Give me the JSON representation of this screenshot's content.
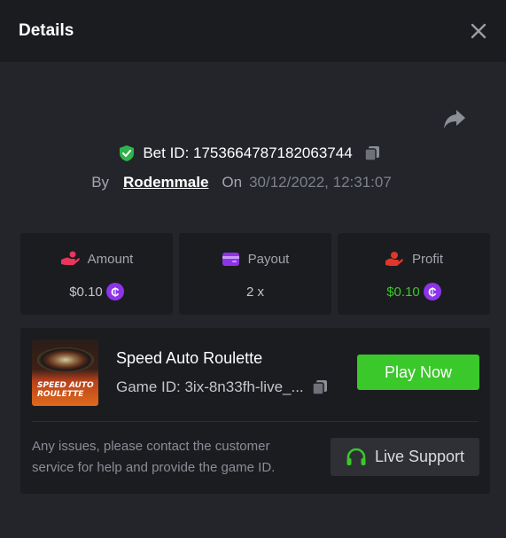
{
  "header": {
    "title": "Details"
  },
  "bet": {
    "label": "Bet ID: 1753664787182063744",
    "by_label": "By",
    "username": "Rodemmale",
    "on_label": "On",
    "date": "30/12/2022, 12:31:07"
  },
  "stats": {
    "amount": {
      "label": "Amount",
      "value": "$0.10",
      "coin": "₵"
    },
    "payout": {
      "label": "Payout",
      "value": "2 x"
    },
    "profit": {
      "label": "Profit",
      "value": "$0.10",
      "coin": "₵"
    }
  },
  "game": {
    "thumb_text": "SPEED AUTO ROULETTE",
    "title": "Speed Auto Roulette",
    "id_label": "Game ID: 3ix-8n33fh-live_...",
    "play_label": "Play Now"
  },
  "support": {
    "text": "Any issues, please contact the customer service for help and provide the game ID.",
    "button_label": "Live Support"
  },
  "colors": {
    "accent_green": "#3ac82a",
    "coin_purple": "#8d34e8",
    "amount_icon": "#e8365c",
    "payout_icon": "#8d34e8",
    "profit_icon": "#e0362c"
  },
  "icons": {
    "close": "close-icon",
    "share": "share-icon",
    "shield": "shield-check-icon",
    "copy": "copy-icon",
    "amount": "bet-hand-icon",
    "payout": "wallet-card-icon",
    "profit": "profit-hand-icon",
    "support": "headset-icon"
  }
}
